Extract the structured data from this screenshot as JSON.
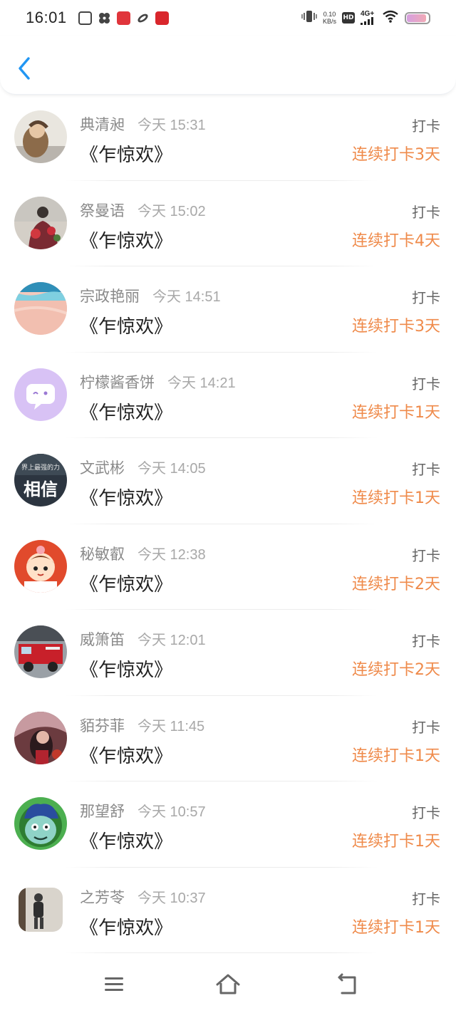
{
  "status_bar": {
    "time": "16:01",
    "net_speed_value": "0.10",
    "net_speed_unit": "KB/s",
    "hd_label": "HD",
    "network_label": "4G+",
    "battery_level": 0.9
  },
  "header": {
    "back_icon": "chevron-left-icon"
  },
  "records": [
    {
      "name": "典清昶",
      "time": "今天 15:31",
      "title": "《乍惊欢》",
      "action": "打卡",
      "streak": "连续打卡3天"
    },
    {
      "name": "祭曼语",
      "time": "今天 15:02",
      "title": "《乍惊欢》",
      "action": "打卡",
      "streak": "连续打卡4天"
    },
    {
      "name": "宗政艳丽",
      "time": "今天 14:51",
      "title": "《乍惊欢》",
      "action": "打卡",
      "streak": "连续打卡3天"
    },
    {
      "name": "柠檬酱香饼",
      "time": "今天 14:21",
      "title": "《乍惊欢》",
      "action": "打卡",
      "streak": "连续打卡1天"
    },
    {
      "name": "文武彬",
      "time": "今天 14:05",
      "title": "《乍惊欢》",
      "action": "打卡",
      "streak": "连续打卡1天",
      "avatar_text": "相信",
      "avatar_subtext": "界上最强的力"
    },
    {
      "name": "秘敏叡",
      "time": "今天 12:38",
      "title": "《乍惊欢》",
      "action": "打卡",
      "streak": "连续打卡2天"
    },
    {
      "name": "威箫笛",
      "time": "今天 12:01",
      "title": "《乍惊欢》",
      "action": "打卡",
      "streak": "连续打卡2天"
    },
    {
      "name": "貊芬菲",
      "time": "今天 11:45",
      "title": "《乍惊欢》",
      "action": "打卡",
      "streak": "连续打卡1天"
    },
    {
      "name": "那望舒",
      "time": "今天 10:57",
      "title": "《乍惊欢》",
      "action": "打卡",
      "streak": "连续打卡1天"
    },
    {
      "name": "之芳苓",
      "time": "今天 10:37",
      "title": "《乍惊欢》",
      "action": "打卡",
      "streak": "连续打卡1天"
    }
  ],
  "colors": {
    "accent_blue": "#2196f3",
    "streak_orange": "#ef8a4a",
    "name_gray": "#8a8a8a"
  },
  "navbar": {
    "menu_icon": "menu-icon",
    "home_icon": "home-icon",
    "back_icon": "back-icon"
  }
}
